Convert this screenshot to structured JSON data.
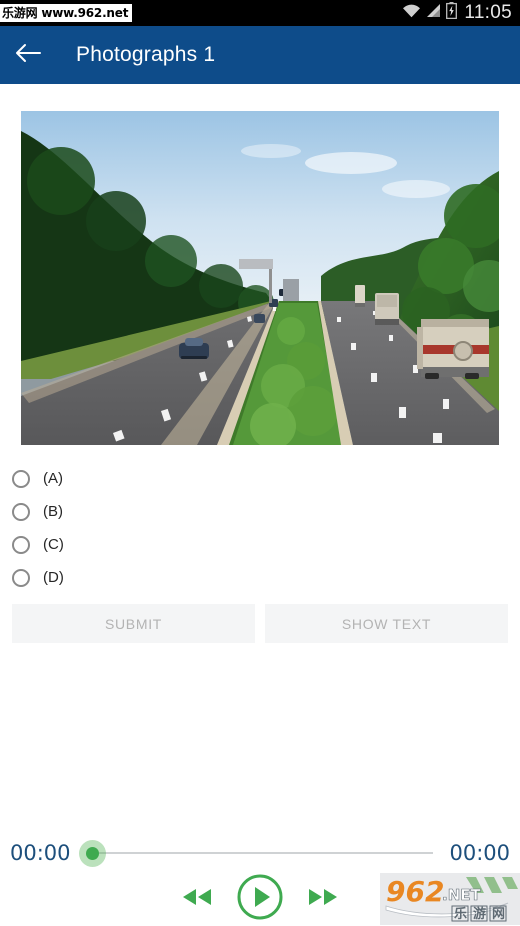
{
  "status_bar": {
    "site_watermark": "乐游网 www.962.net",
    "clock": "11:05",
    "icons": [
      "wifi-icon",
      "signal-icon",
      "battery-icon"
    ]
  },
  "app_bar": {
    "back_icon": "back-arrow-icon",
    "title": "Photographs 1",
    "background_color": "#0e4c8a"
  },
  "photo": {
    "alt": "Aerial view of a divided highway with cars and trucks, green trees on both sides and a vegetated median under a blue sky"
  },
  "options": [
    {
      "label": "(A)",
      "selected": false
    },
    {
      "label": "(B)",
      "selected": false
    },
    {
      "label": "(C)",
      "selected": false
    },
    {
      "label": "(D)",
      "selected": false
    }
  ],
  "actions": {
    "submit_label": "SUBMIT",
    "show_text_label": "SHOW TEXT",
    "disabled_text_color": "#b3b3b3",
    "background_color": "#f4f5f6"
  },
  "player": {
    "current_time": "00:00",
    "total_time": "00:00",
    "progress_percent": 0,
    "accent_color": "#3faa50",
    "time_color": "#1d4f7c",
    "rewind_icon": "rewind-icon",
    "play_icon": "play-icon",
    "forward_icon": "fast-forward-icon"
  },
  "logo_watermark": {
    "number_text": "962",
    "dot_text": ".",
    "net_text": "NET",
    "chinese_text": "乐游网"
  }
}
